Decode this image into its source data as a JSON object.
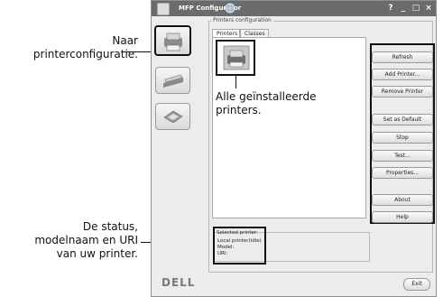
{
  "window": {
    "title": "MFP Configurator",
    "controls": {
      "help": "?",
      "minimize": "_",
      "maximize": "□",
      "close": "×"
    }
  },
  "left_buttons": [
    {
      "name": "printer-configuration",
      "icon": "printer-icon"
    },
    {
      "name": "scanner-configuration",
      "icon": "scanner-icon"
    },
    {
      "name": "port-configuration",
      "icon": "port-icon"
    }
  ],
  "printers_group": {
    "label": "Printers configuration",
    "tabs": [
      "Printers",
      "Classes"
    ]
  },
  "action_buttons": [
    "Refresh",
    "Add Printer...",
    "Remove Printer",
    "Set as Default",
    "Stop",
    "Test...",
    "Properties...",
    "About",
    "Help"
  ],
  "selected_printer": {
    "label": "Selected printer:",
    "lines": [
      "Local printer(idle)",
      "Model:",
      "URI:"
    ]
  },
  "footer": {
    "logo": "DELL",
    "exit_label": "Exit"
  },
  "annotations": {
    "left_top": [
      "Naar",
      "printerconfiguratie."
    ],
    "center": [
      "Alle geïnstalleerde",
      "printers."
    ],
    "left_bottom": [
      "De status,",
      "modelnaam en URI",
      "van uw printer."
    ]
  }
}
